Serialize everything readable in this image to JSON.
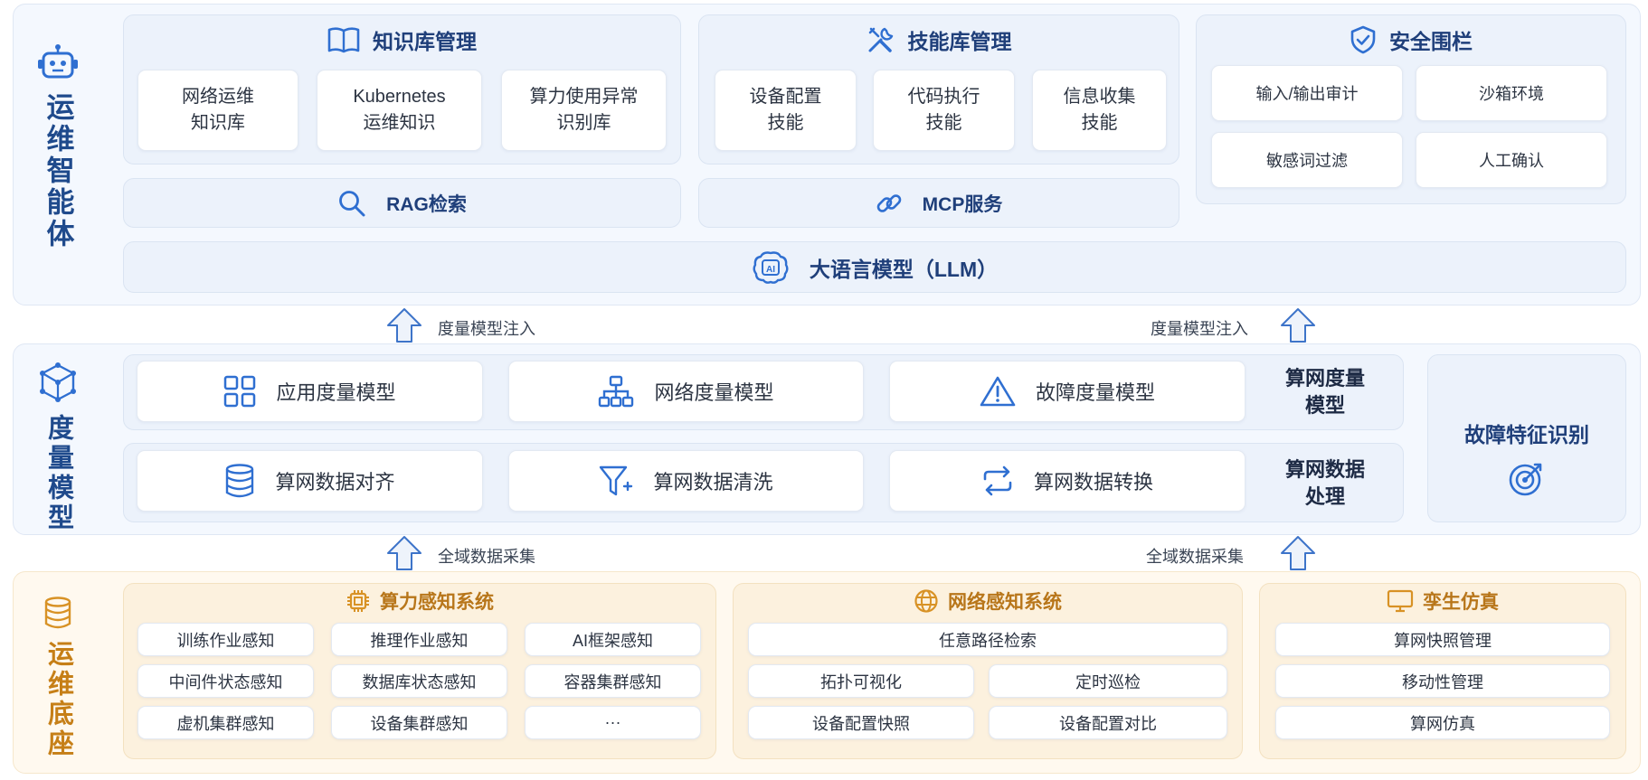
{
  "colors": {
    "blue": "#2f6fd1",
    "navy": "#1f3f7a",
    "orange": "#d89225",
    "layer_blue": "#f4f8fe",
    "layer_orange": "#fff9ef"
  },
  "agent_layer": {
    "title": "运维智能体",
    "icon": "robot-icon",
    "knowledge": {
      "title": "知识库管理",
      "icon": "book-icon",
      "items": [
        "网络运维\n知识库",
        "Kubernetes\n运维知识",
        "算力使用异常\n识别库"
      ]
    },
    "skills": {
      "title": "技能库管理",
      "icon": "tools-icon",
      "items": [
        "设备配置\n技能",
        "代码执行\n技能",
        "信息收集\n技能"
      ]
    },
    "security": {
      "title": "安全围栏",
      "icon": "shield-check-icon",
      "items": [
        "输入/输出审计",
        "沙箱环境",
        "敏感词过滤",
        "人工确认"
      ]
    },
    "rag": {
      "label": "RAG检索",
      "icon": "search-icon"
    },
    "mcp": {
      "label": "MCP服务",
      "icon": "link-icon"
    },
    "llm": {
      "label": "大语言模型（LLM）",
      "icon": "ai-brain-icon"
    }
  },
  "arrows_top": {
    "left_label": "度量模型注入",
    "right_label": "度量模型注入"
  },
  "metric_layer": {
    "title": "度量模型",
    "icon": "cube-network-icon",
    "row1": {
      "items": [
        {
          "label": "应用度量模型",
          "icon": "grid-icon"
        },
        {
          "label": "网络度量模型",
          "icon": "hierarchy-icon"
        },
        {
          "label": "故障度量模型",
          "icon": "warning-icon"
        }
      ],
      "label": "算网度量\n模型"
    },
    "row2": {
      "items": [
        {
          "label": "算网数据对齐",
          "icon": "database-icon"
        },
        {
          "label": "算网数据清洗",
          "icon": "filter-icon"
        },
        {
          "label": "算网数据转换",
          "icon": "convert-icon"
        }
      ],
      "label": "算网数据\n处理"
    },
    "fault": {
      "label": "故障特征识别",
      "icon": "target-icon"
    }
  },
  "arrows_bottom": {
    "left_label": "全域数据采集",
    "right_label": "全域数据采集"
  },
  "base_layer": {
    "title": "运维底座",
    "icon": "database-stack-icon",
    "compute": {
      "title": "算力感知系统",
      "icon": "chip-icon",
      "items": [
        "训练作业感知",
        "推理作业感知",
        "AI框架感知",
        "中间件状态感知",
        "数据库状态感知",
        "容器集群感知",
        "虚机集群感知",
        "设备集群感知",
        "···"
      ]
    },
    "network": {
      "title": "网络感知系统",
      "icon": "globe-icon",
      "items": [
        "任意路径检索",
        "拓扑可视化",
        "定时巡检",
        "设备配置快照",
        "设备配置对比"
      ]
    },
    "twin": {
      "title": "孪生仿真",
      "icon": "monitor-icon",
      "items": [
        "算网快照管理",
        "移动性管理",
        "算网仿真"
      ]
    }
  }
}
